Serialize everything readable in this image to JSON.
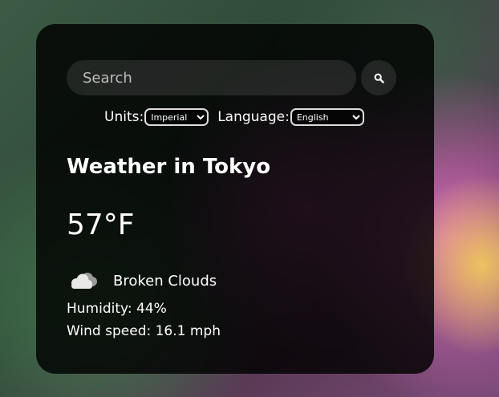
{
  "search": {
    "placeholder": "Search",
    "button_icon": "search-icon"
  },
  "controls": {
    "units_label": "Units:",
    "units_options": [
      "Imperial"
    ],
    "units_selected": "Imperial",
    "language_label": "Language:",
    "language_options": [
      "English"
    ],
    "language_selected": "English"
  },
  "weather": {
    "title": "Weather in Tokyo",
    "temperature": "57°F",
    "icon": "broken-clouds-icon",
    "description": "Broken Clouds",
    "humidity": "Humidity: 44%",
    "wind": "Wind speed: 16.1 mph"
  }
}
